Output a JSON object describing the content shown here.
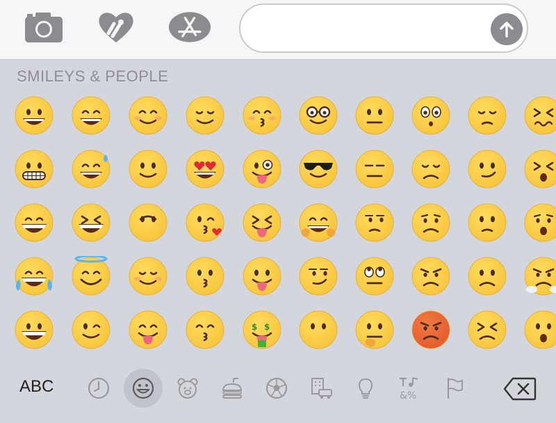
{
  "top_bar": {
    "apps": [
      {
        "name": "camera",
        "icon": "camera-icon"
      },
      {
        "name": "digital-touch",
        "icon": "heart-hands-icon"
      },
      {
        "name": "app-store",
        "icon": "app-store-icon"
      }
    ],
    "message_placeholder": "",
    "send_icon": "arrow-up-icon"
  },
  "emoji_panel": {
    "section_title": "SMILEYS & PEOPLE"
  },
  "bottom_bar": {
    "abc_label": "ABC",
    "categories": [
      {
        "name": "recent",
        "icon": "clock-icon"
      },
      {
        "name": "smileys",
        "icon": "smiley-icon",
        "active": true
      },
      {
        "name": "animals",
        "icon": "bear-icon"
      },
      {
        "name": "food",
        "icon": "burger-icon"
      },
      {
        "name": "activity",
        "icon": "soccer-ball-icon"
      },
      {
        "name": "travel",
        "icon": "building-car-icon"
      },
      {
        "name": "objects",
        "icon": "lightbulb-icon"
      },
      {
        "name": "symbols",
        "icon": "symbols-icon"
      },
      {
        "name": "flags",
        "icon": "flag-icon"
      }
    ],
    "delete_icon": "backspace-icon"
  },
  "colors": {
    "emoji_yellow": "#f7c53b",
    "angry_red": "#e55a2b",
    "ui_gray": "#8c8c90"
  }
}
